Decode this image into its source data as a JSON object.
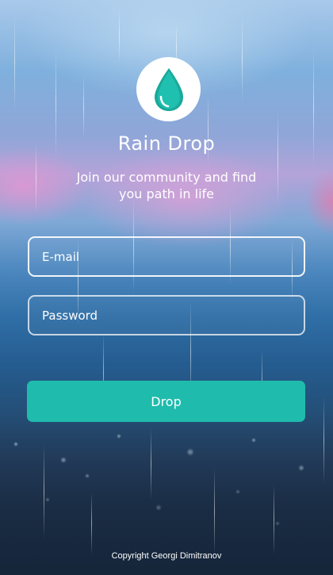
{
  "app": {
    "title": "Rain Drop",
    "tagline_line1": "Join our community and find",
    "tagline_line2": "you path in life",
    "logo_icon": "water-drop-icon",
    "accent_color": "#1fbcad"
  },
  "form": {
    "email_placeholder": "E-mail",
    "email_value": "",
    "password_placeholder": "Password",
    "password_value": "",
    "submit_label": "Drop"
  },
  "footer": {
    "copyright": "Copyright Georgi Dimitranov"
  }
}
